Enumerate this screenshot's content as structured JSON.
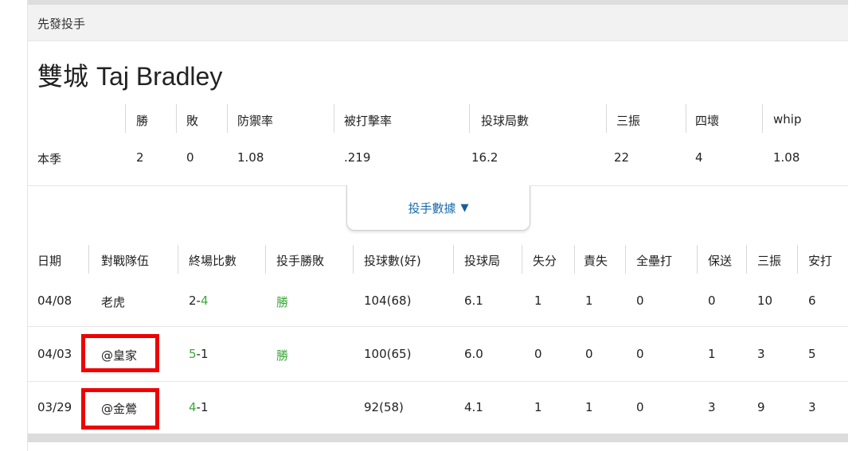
{
  "section_title": "先發投手",
  "pitcher": {
    "team": "雙城",
    "name": "Taj Bradley"
  },
  "season": {
    "headers": [
      "勝",
      "敗",
      "防禦率",
      "被打擊率",
      "投球局數",
      "三振",
      "四壞",
      "whip"
    ],
    "row_label": "本季",
    "values": [
      "2",
      "0",
      "1.08",
      ".219",
      "16.2",
      "22",
      "4",
      "1.08"
    ]
  },
  "toggle": {
    "label": "投手數據",
    "arrow": "▼"
  },
  "games": {
    "headers": [
      "日期",
      "對戰隊伍",
      "終場比數",
      "投手勝敗",
      "投球數(好)",
      "投球局",
      "失分",
      "責失",
      "全壘打",
      "保送",
      "三振",
      "安打"
    ],
    "rows": [
      {
        "date": "04/08",
        "opponent": "老虎",
        "score_a": "2",
        "score_dash": "-",
        "score_b": "4",
        "green_side": "b",
        "result": "勝",
        "pitches": "104(68)",
        "ip": "6.1",
        "r": "1",
        "er": "1",
        "hr": "0",
        "bb": "0",
        "so": "10",
        "h": "6",
        "highlighted": false
      },
      {
        "date": "04/03",
        "opponent": "@皇家",
        "score_a": "5",
        "score_dash": "-",
        "score_b": "1",
        "green_side": "a",
        "result": "勝",
        "pitches": "100(65)",
        "ip": "6.0",
        "r": "0",
        "er": "0",
        "hr": "0",
        "bb": "1",
        "so": "3",
        "h": "5",
        "highlighted": true
      },
      {
        "date": "03/29",
        "opponent": "@金鶯",
        "score_a": "4",
        "score_dash": "-",
        "score_b": "1",
        "green_side": "a",
        "result": "",
        "pitches": "92(58)",
        "ip": "4.1",
        "r": "1",
        "er": "1",
        "hr": "0",
        "bb": "3",
        "so": "9",
        "h": "3",
        "highlighted": true
      }
    ]
  },
  "colors": {
    "win_green": "#3aa83a",
    "highlight_red": "#f00000",
    "link_blue": "#1a6aa8"
  }
}
